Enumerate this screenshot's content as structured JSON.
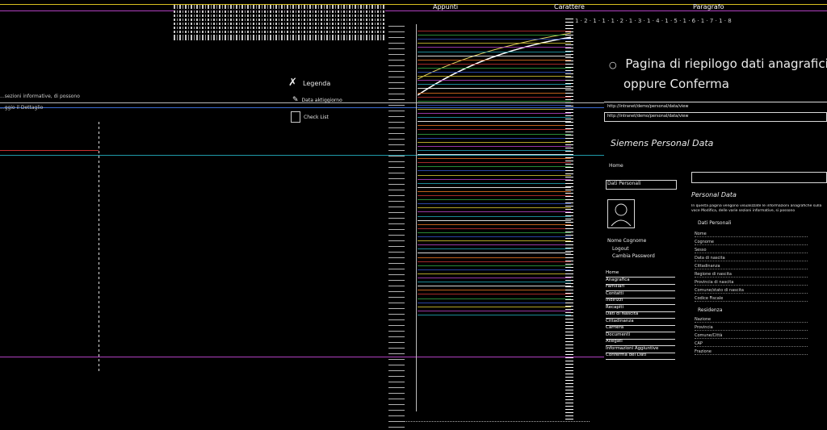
{
  "left": {
    "ribbon_tabs": "",
    "links": [
      {
        "label": "Legenda",
        "icon": "legend-icon"
      },
      {
        "label": "Data aktiggiorno",
        "icon": "calendar-icon"
      },
      {
        "label": "Check List",
        "icon": "checklist-icon"
      }
    ],
    "text_1": "...sezioni informative, di possono",
    "text_2": "...ggio il Dettaglio"
  },
  "top_tabs": [
    "Appunti",
    "Carattere",
    "Paragrafo"
  ],
  "right": {
    "bullet_line_1": "Pagina di riepilogo dati anagrafici pa",
    "bullet_line_2": "oppure Conferma",
    "ruler": "1 · 2 · 1 · 1 · 1 · 2 · 1 · 3 · 1 · 4 · 1 · 5 · 1 · 6 · 1 · 7 · 1 · 8",
    "shot": {
      "url": "http://intranet/demo/personal/data/view",
      "site_title": "Siemens Personal Data",
      "home": "Home",
      "sidebar_head": "Dati Personali",
      "user_name": "Nome Cognome",
      "user_links": [
        "Logout",
        "Cambia Password"
      ],
      "nav": [
        "Home",
        "Anagrafica",
        "Familiari",
        "Contatti",
        "Indirizzi",
        "Recapiti",
        "Dati di Nascita",
        "Cittadinanza",
        "Carriera",
        "Documenti",
        "Allegati",
        "Informazioni Aggiuntive",
        "Conferma dei Dati"
      ],
      "page_title": "Personal Data",
      "intro": "In questa pagina vengono visualizzate le informazioni anagrafiche sulla voce Modifica, delle varie sezioni informative, si possono",
      "section_1": "Dati Personali",
      "fields": [
        "Nome",
        "Cognome",
        "Sesso",
        "Data di nascita",
        "Cittadinanza",
        "Regione di nascita",
        "Provincia di nascita",
        "Comune/stato di nascita",
        "Codice Fiscale"
      ],
      "section_2": "Residenza",
      "fields_2": [
        "Nazione",
        "Provincia",
        "Comune/Città",
        "CAP",
        "Frazione"
      ]
    }
  },
  "colors": {
    "background": "#000000",
    "accent_cyan": "#1f9aa8",
    "accent_magenta": "#b040c0",
    "accent_yellow": "#e0d020"
  }
}
